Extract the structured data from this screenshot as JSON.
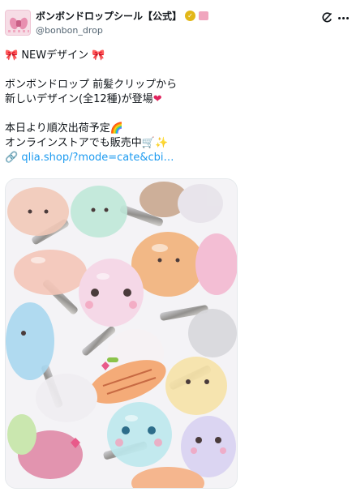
{
  "account": {
    "display_name": "ボンボンドロップシール【公式】",
    "handle": "@bonbon_drop"
  },
  "tweet": {
    "line1_text": " NEWデザイン ",
    "line2": "ボンボンドロップ 前髪クリップから",
    "line3_text": "新しいデザイン(全12種)が登場",
    "line4_text": "本日より順次出荷予定",
    "line5_text": "オンラインストアでも販売中",
    "link_text": "qlia.shop/?mode=cate&cbi…"
  },
  "icons": {
    "ribbon": "🎀",
    "heart": "❤",
    "rainbow": "🌈",
    "cart": "🛒",
    "sparkles": "✨",
    "link": "🔗"
  },
  "media": {
    "colors": [
      "#f2c9b8",
      "#bfe8d9",
      "#c9a88f",
      "#f2b27a",
      "#d9d2f2",
      "#f3b9d1",
      "#a9d8f0",
      "#f7d774",
      "#e08aa8"
    ]
  }
}
